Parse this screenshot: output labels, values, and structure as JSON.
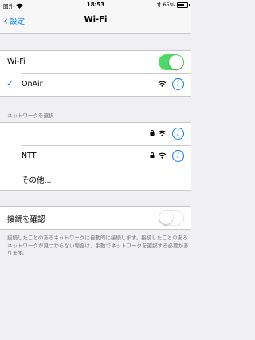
{
  "status_bar": {
    "carrier": "圏外",
    "time": "18:53",
    "battery": "65%",
    "battery_level": 0.65
  },
  "nav": {
    "back_label": "設定",
    "title": "Wi-Fi"
  },
  "wifi_section": {
    "wifi_label": "Wi-Fi",
    "wifi_enabled": true,
    "connected_network": "OnAir"
  },
  "networks_section": {
    "header": "ネットワークを選択...",
    "networks": [
      {
        "name": "",
        "secured": true
      },
      {
        "name": "NTT",
        "secured": true
      }
    ],
    "other_label": "その他..."
  },
  "ask_section": {
    "label": "接続を確認",
    "enabled": false,
    "footer": "接続したことのあるネットワークに自動的に接続します。接続したことのあるネットワークが見つからない場合は、手動でネットワークを選択する必要があります。"
  },
  "colors": {
    "accent": "#007aff",
    "toggle_on": "#4cd964"
  }
}
